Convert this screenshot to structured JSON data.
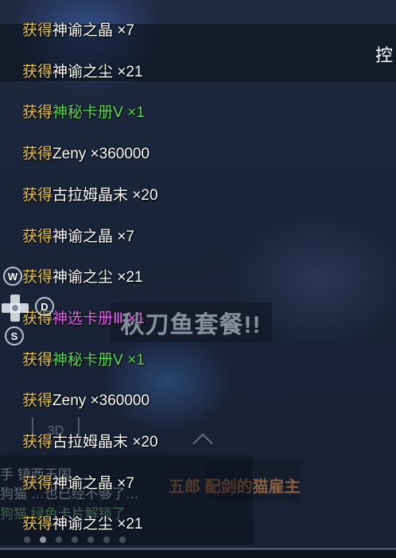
{
  "header": {
    "partial_title": "控"
  },
  "loot_messages": [
    {
      "prefix": "获得",
      "item": "神谕之晶",
      "qty": "×7",
      "rarity": "white"
    },
    {
      "prefix": "获得",
      "item": "神谕之尘",
      "qty": "×21",
      "rarity": "white"
    },
    {
      "prefix": "获得",
      "item": "神秘卡册Ⅴ",
      "qty": "×1",
      "rarity": "green"
    },
    {
      "prefix": "获得",
      "item": "Zeny",
      "qty": "×360000",
      "rarity": "white"
    },
    {
      "prefix": "获得",
      "item": "古拉姆晶末",
      "qty": "×20",
      "rarity": "white"
    },
    {
      "prefix": "获得",
      "item": "神谕之晶",
      "qty": "×7",
      "rarity": "white"
    },
    {
      "prefix": "获得",
      "item": "神谕之尘",
      "qty": "×21",
      "rarity": "white"
    },
    {
      "prefix": "获得",
      "item": "神选卡册Ⅲ",
      "qty": "×1",
      "rarity": "purple"
    },
    {
      "prefix": "获得",
      "item": "神秘卡册Ⅴ",
      "qty": "×1",
      "rarity": "green"
    },
    {
      "prefix": "获得",
      "item": "Zeny",
      "qty": "×360000",
      "rarity": "white"
    },
    {
      "prefix": "获得",
      "item": "古拉姆晶末",
      "qty": "×20",
      "rarity": "white"
    },
    {
      "prefix": "获得",
      "item": "神谕之晶",
      "qty": "×7",
      "rarity": "white"
    },
    {
      "prefix": "获得",
      "item": "神谕之尘",
      "qty": "×21",
      "rarity": "white"
    }
  ],
  "controls": {
    "w": "W",
    "s": "S",
    "d": "D"
  },
  "scene": {
    "banner": "秋刀鱼套餐!!",
    "sub_banner": "五郎 配剑的猫雇主",
    "frame_label": "3D"
  },
  "chat": {
    "line1": "手 镇西王国…",
    "line2": "狗猫  …也已经不够了…",
    "line3": "狗猫   绿色卡片解锁了"
  },
  "colors": {
    "prefix": "#e8c64a",
    "white_item": "#ffffff",
    "green_item": "#56d65a",
    "purple_item": "#e066e8"
  }
}
